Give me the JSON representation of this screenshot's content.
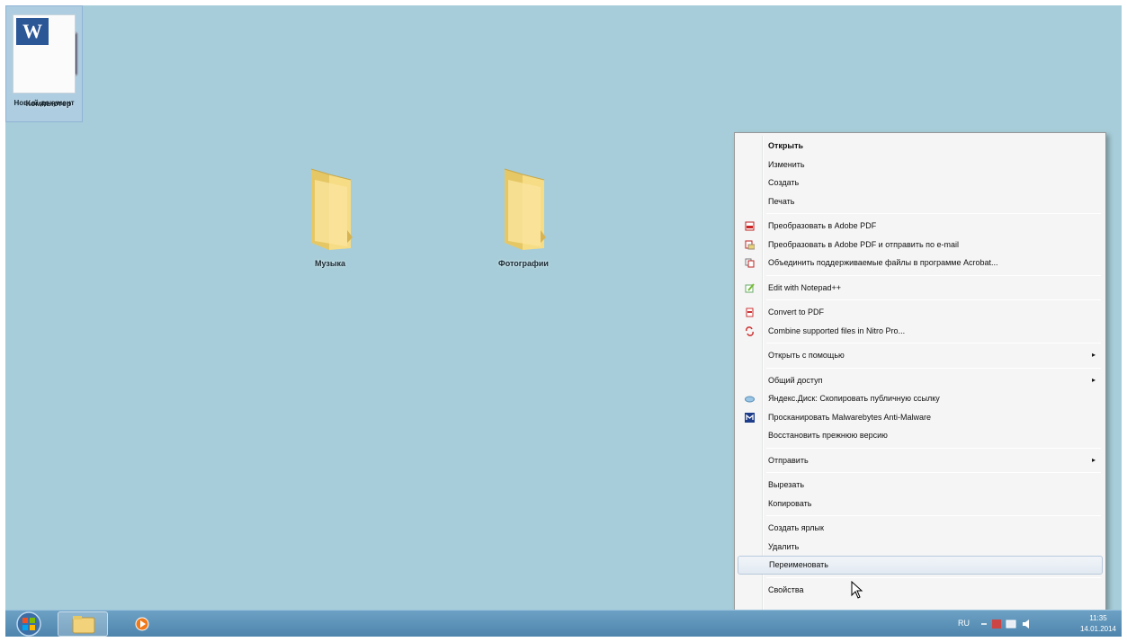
{
  "desktop": {
    "icons": [
      {
        "label": "Компьютер"
      },
      {
        "label": "Музыка"
      },
      {
        "label": "Фотографии"
      },
      {
        "label": "Новый документ"
      }
    ]
  },
  "context_menu": {
    "items": [
      {
        "label": "Открыть",
        "bold": true
      },
      {
        "label": "Изменить"
      },
      {
        "label": "Создать"
      },
      {
        "label": "Печать"
      },
      {
        "label": "Преобразовать в Adobe PDF",
        "icon": "adobe-pdf-icon"
      },
      {
        "label": "Преобразовать в Adobe PDF и отправить по e-mail",
        "icon": "adobe-pdf-mail-icon"
      },
      {
        "label": "Объединить поддерживаемые файлы в программе Acrobat...",
        "icon": "acrobat-combine-icon"
      },
      {
        "label": "Edit with Notepad++",
        "icon": "notepad-plus-plus-icon"
      },
      {
        "label": "Convert to PDF",
        "icon": "nitro-pdf-icon"
      },
      {
        "label": "Combine supported files in Nitro Pro...",
        "icon": "nitro-combine-icon"
      },
      {
        "label": "Открыть с помощью",
        "submenu": true
      },
      {
        "label": "Общий доступ",
        "submenu": true
      },
      {
        "label": "Яндекс.Диск: Скопировать публичную ссылку",
        "icon": "yandex-disk-icon"
      },
      {
        "label": "Просканировать Malwarebytes Anti-Malware",
        "icon": "malwarebytes-icon"
      },
      {
        "label": "Восстановить прежнюю версию"
      },
      {
        "label": "Отправить",
        "submenu": true
      },
      {
        "label": "Вырезать"
      },
      {
        "label": "Копировать"
      },
      {
        "label": "Создать ярлык"
      },
      {
        "label": "Удалить"
      },
      {
        "label": "Переименовать"
      },
      {
        "label": "Свойства"
      }
    ]
  },
  "taskbar": {
    "language": "RU",
    "time": "11:35",
    "date": "14.01.2014"
  },
  "colors": {
    "desktop_bg": "#a6cdd9",
    "taskbar": "#5a8fb6",
    "menu_bg": "#f5f5f5",
    "highlight": "#e1e9f1"
  }
}
